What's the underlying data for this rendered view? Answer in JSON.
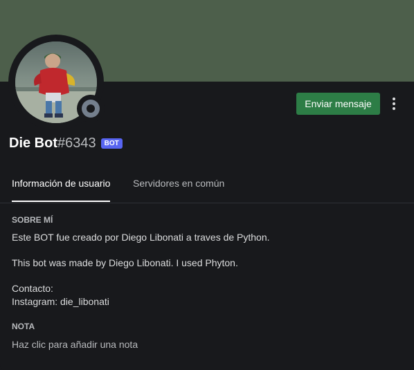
{
  "colors": {
    "banner": "#4d5f4b",
    "button_green": "#2d7d46",
    "bot_tag": "#5865f2",
    "status_offline": "#747f8d"
  },
  "profile": {
    "username": "Die Bot",
    "discriminator": "#6343",
    "bot_tag": "BOT",
    "status": "offline"
  },
  "actions": {
    "send_message": "Enviar mensaje",
    "more_icon": "more-vertical-icon"
  },
  "tabs": [
    {
      "label": "Información de usuario",
      "active": true
    },
    {
      "label": "Servidores en común",
      "active": false
    }
  ],
  "about": {
    "title": "SOBRE MÍ",
    "lines": [
      "Este BOT fue creado por Diego Libonati a traves de Python.",
      "This bot was made by Diego Libonati. I used Phyton.",
      "Contacto:",
      "Instagram: die_libonati"
    ]
  },
  "note": {
    "title": "NOTA",
    "placeholder": "Haz clic para añadir una nota"
  }
}
